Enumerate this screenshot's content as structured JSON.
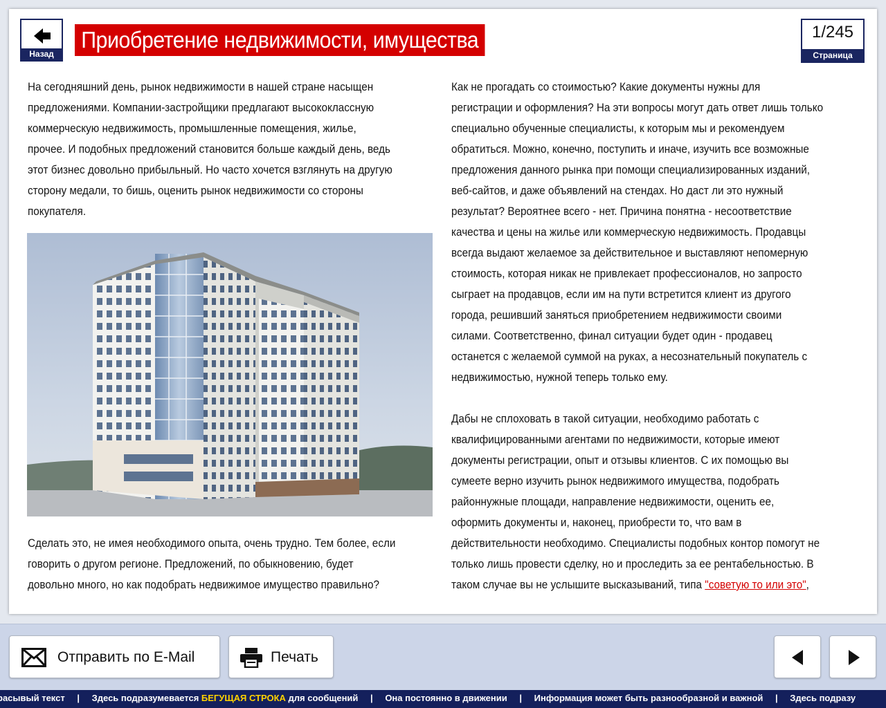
{
  "header": {
    "back_label": "Назад",
    "title": "Приобретение недвижимости, имущества",
    "page_number": "1/245",
    "page_label": "Страница"
  },
  "content": {
    "left_p1": "На сегодняшний день, рынок недвижимости в нашей стране насыщен\nпредложениями. Компании-застройщики предлагают высококлассную\nкоммерческую недвижимость, промышленные помещения, жилье,\nпрочее. И подобных предложений становится больше каждый день, ведь\nэтот бизнес довольно прибыльный. Но часто хочется взглянуть на другую\nсторону медали, то бишь, оценить рынок недвижимости со стороны\nпокупателя.",
    "left_p2": "Сделать это, не имея необходимого опыта, очень трудно. Тем более, если\nговорить о другом регионе. Предложений, по обыкновению, будет\nдовольно много, но как подобрать недвижимое имущество правильно?",
    "right_p1": " Как не прогадать со стоимостью? Какие документы нужны для\nрегистрации и оформления? На эти вопросы могут дать ответ лишь только\nспециально обученные специалисты, к которым мы и рекомендуем\nобратиться. Можно, конечно, поступить и иначе, изучить все возможные\nпредложения данного рынка при помощи специализированных изданий,\nвеб-сайтов, и даже объявлений на стендах. Но даст ли это нужный\nрезультат? Вероятнее всего - нет. Причина понятна - несоответствие\nкачества и цены на жилье или коммерческую недвижимость. Продавцы\nвсегда выдают желаемое за действительное и выставляют непомерную\nстоимость, которая никак не привлекает профессионалов, но запросто\nсыграет на продавцов, если им на пути встретится клиент из другого\nгорода, решивший заняться приобретением недвижимости своими\nсилами. Соответственно, финал ситуации будет один - продавец\nостанется с желаемой суммой на руках, а несознательный покупатель с\nнедвижимостью, нужной теперь только ему.",
    "right_p2": "Дабы не сплоховать в такой ситуации, необходимо работать с\nквалифицированными агентами по недвижимости, которые имеют\nдокументы регистрации, опыт и отзывы клиентов. С их помощью вы\nсумеете верно изучить рынок недвижимого имущества, подобрать\nрайоннужные площади, направление недвижимости, оценить ее,\nоформить документы и, наконец, приобрести то, что вам в\nдействительности необходимо. Специалисты подобных контор помогут не\nтолько лишь провести сделку, но и проследить за ее рентабельностью. В\nтаком случае вы не услышите высказываний, типа ",
    "link_text": "\"советую то или это\"",
    "after_link": ","
  },
  "toolbar": {
    "email_label": "Отправить по E-Mail",
    "print_label": "Печать"
  },
  "ticker": {
    "item1": "расывый текст",
    "item2_pre": "Здесь подразумевается ",
    "item2_hl": "БЕГУЩАЯ СТРОКА",
    "item2_post": " для сообщений",
    "item3": "Она постоянно в движении",
    "item4": "Информация может быть разнообразной и важной",
    "item5": "Здесь подразу",
    "separator": "|"
  },
  "icons": {
    "back": "arrow-left-icon",
    "email": "envelope-icon",
    "print": "printer-icon",
    "prev": "triangle-left-icon",
    "next": "triangle-right-icon"
  },
  "colors": {
    "accent_red": "#d40000",
    "navy": "#1a2560",
    "ticker_bg": "#14205c",
    "ticker_highlight": "#ffd200"
  }
}
